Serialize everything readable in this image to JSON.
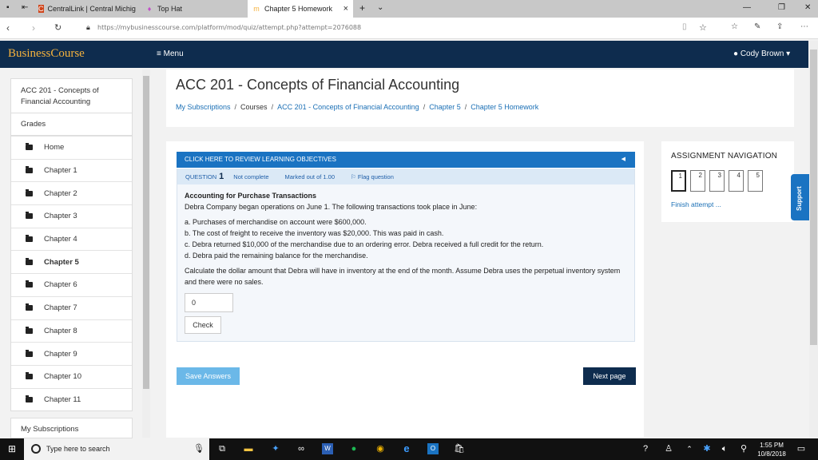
{
  "browser": {
    "tabs": [
      {
        "label": "CentralLink | Central Michig"
      },
      {
        "label": "Top Hat"
      },
      {
        "label": "Chapter 5 Homework"
      }
    ],
    "url": "https://mybusinesscourse.com/platform/mod/quiz/attempt.php?attempt=2076088"
  },
  "site": {
    "logo": "BusinessCourse",
    "menu_label": "Menu",
    "user_name": "Cody Brown"
  },
  "sidebar": {
    "course": "ACC 201 - Concepts of Financial Accounting",
    "grades": "Grades",
    "items": [
      "Home",
      "Chapter 1",
      "Chapter 2",
      "Chapter 3",
      "Chapter 4",
      "Chapter 5",
      "Chapter 6",
      "Chapter 7",
      "Chapter 8",
      "Chapter 9",
      "Chapter 10",
      "Chapter 11"
    ],
    "my_subscriptions": "My Subscriptions"
  },
  "page": {
    "title": "ACC 201 - Concepts of Financial Accounting",
    "breadcrumbs": [
      "My Subscriptions",
      "Courses",
      "ACC 201 - Concepts of Financial Accounting",
      "Chapter 5",
      "Chapter 5 Homework"
    ]
  },
  "quiz": {
    "objectives_label": "CLICK HERE TO REVIEW LEARNING OBJECTIVES",
    "question_label": "QUESTION",
    "question_number": "1",
    "status": "Not complete",
    "marked_out_of": "Marked out of 1.00",
    "flag_label": "Flag question",
    "heading": "Accounting for Purchase Transactions",
    "intro": "Debra Company began operations on June 1. The following transactions took place in June:",
    "transactions": [
      "a. Purchases of merchandise on account were $600,000.",
      "b. The cost of freight to receive the inventory was $20,000. This was paid in cash.",
      "c. Debra returned $10,000 of the merchandise due to an ordering error. Debra received a full credit for the return.",
      "d. Debra paid the remaining balance for the merchandise."
    ],
    "prompt": "Calculate the dollar amount that Debra will have in inventory at the end of the month. Assume Debra uses the perpetual inventory system and there were no sales.",
    "answer_value": "0",
    "check_label": "Check",
    "save_label": "Save Answers",
    "next_label": "Next page"
  },
  "navigation": {
    "title": "ASSIGNMENT NAVIGATION",
    "questions": [
      "1",
      "2",
      "3",
      "4",
      "5"
    ],
    "finish_label": "Finish attempt ..."
  },
  "support_label": "Support",
  "taskbar": {
    "search_placeholder": "Type here to search",
    "time": "1:55 PM",
    "date": "10/8/2018"
  },
  "colors": {
    "header": "#0e2c4e",
    "accent": "#1a73c2",
    "logo": "#f5b23d",
    "link": "#1a6fb5"
  }
}
